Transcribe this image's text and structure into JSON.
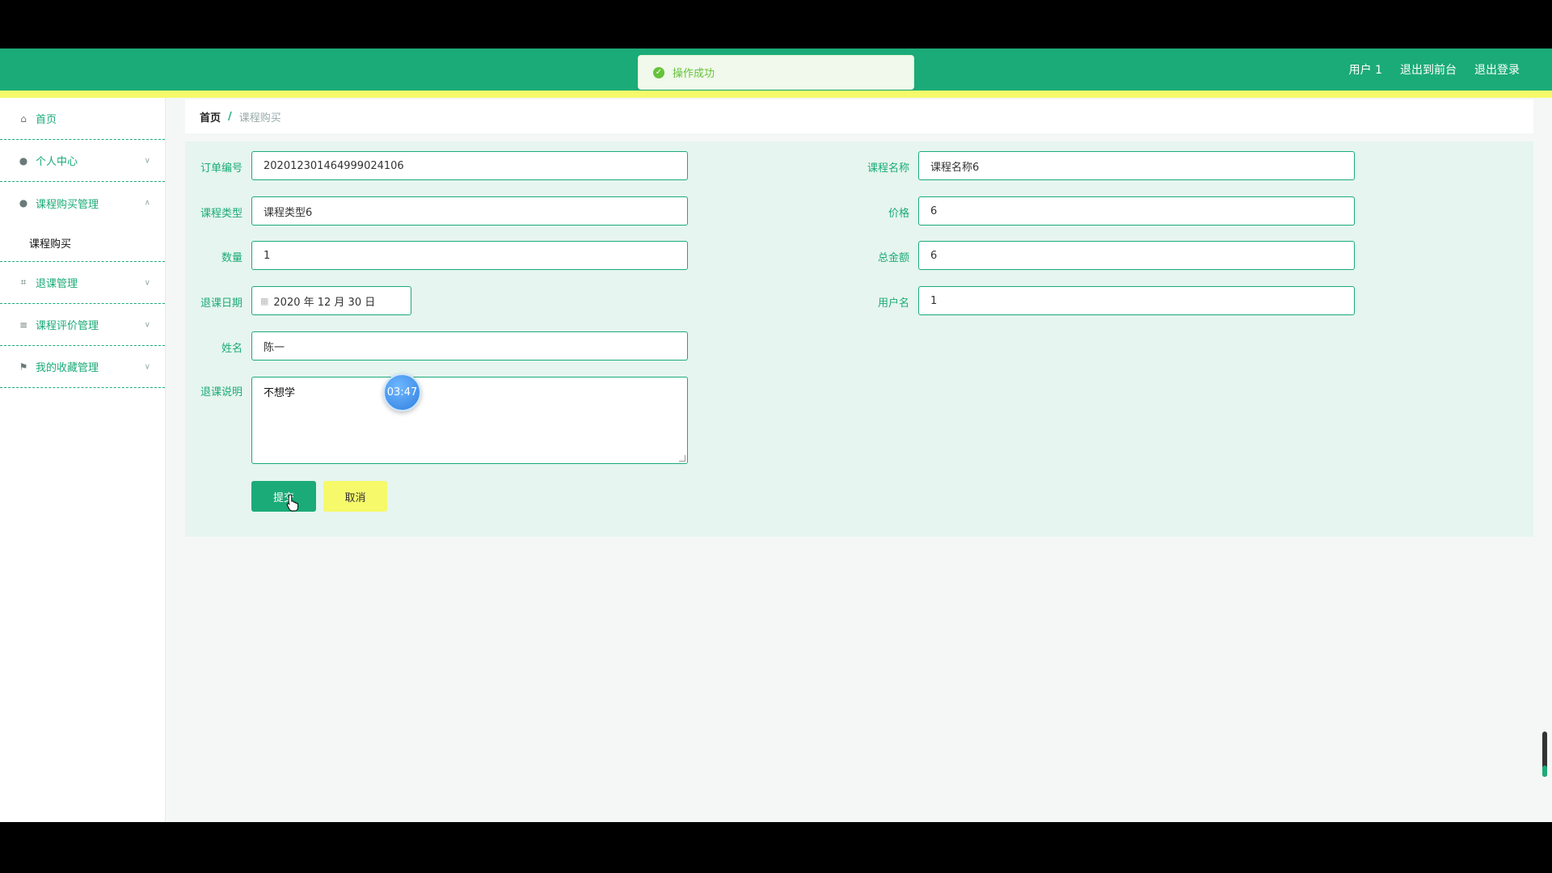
{
  "header": {
    "links": [
      "用户 1",
      "退出到前台",
      "退出登录"
    ]
  },
  "toast": {
    "text": "操作成功",
    "icon": "check-circle-icon"
  },
  "sidebar": {
    "items": [
      {
        "label": "首页",
        "icon": "home-icon"
      },
      {
        "label": "个人中心",
        "icon": "user-icon"
      },
      {
        "label": "课程购买管理",
        "icon": "user-icon",
        "expanded": true,
        "sub": [
          "课程购买"
        ]
      },
      {
        "label": "退课管理",
        "icon": "crop-icon"
      },
      {
        "label": "课程评价管理",
        "icon": "list-icon"
      },
      {
        "label": "我的收藏管理",
        "icon": "flag-icon"
      }
    ]
  },
  "breadcrumb": {
    "home": "首页",
    "sep": "/",
    "current": "课程购买"
  },
  "form": {
    "order_no": {
      "label": "订单编号",
      "value": "20201230146499902410​6"
    },
    "course_name": {
      "label": "课程名称",
      "value": "课程名称6"
    },
    "course_type": {
      "label": "课程类型",
      "value": "课程类型6"
    },
    "price": {
      "label": "价格",
      "value": "6"
    },
    "quantity": {
      "label": "数量",
      "value": "1"
    },
    "total": {
      "label": "总金额",
      "value": "6"
    },
    "drop_date": {
      "label": "退课日期",
      "value": "2020 年 12 月 30 日"
    },
    "username": {
      "label": "用户名",
      "value": "1"
    },
    "name": {
      "label": "姓名",
      "value": "陈一"
    },
    "reason": {
      "label": "退课说明",
      "value": "不想学"
    },
    "submit_label": "提交",
    "cancel_label": "取消"
  },
  "timer": {
    "text": "03:47"
  },
  "colors": {
    "primary": "#1bab78",
    "accent": "#f6f96a"
  }
}
